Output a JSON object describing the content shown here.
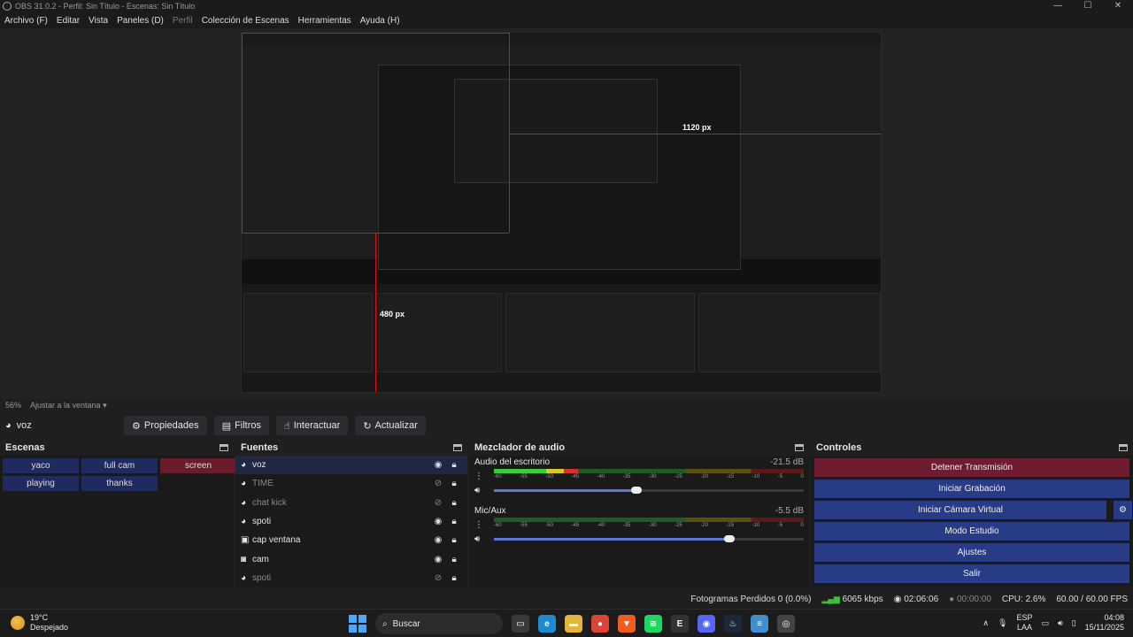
{
  "window": {
    "title": "OBS 31.0.2 - Perfil: Sin Título - Escenas: Sin Título",
    "controls": [
      "—",
      "☐",
      "✕"
    ]
  },
  "menu": [
    "Archivo (F)",
    "Editar",
    "Vista",
    "Paneles (D)",
    "Perfil",
    "Colección de Escenas",
    "Herramientas",
    "Ayuda (H)"
  ],
  "preview": {
    "dimension_h": "1120 px",
    "dimension_v": "480 px",
    "zoom": "56%",
    "fit_label": "Ajustar a la ventana"
  },
  "toolbar": {
    "source": "voz",
    "buttons": [
      {
        "icon": "gear-icon",
        "glyph": "⚙",
        "label": "Propiedades"
      },
      {
        "icon": "filter-icon",
        "glyph": "▤",
        "label": "Filtros"
      },
      {
        "icon": "hand-icon",
        "glyph": "☝",
        "label": "Interactuar"
      },
      {
        "icon": "refresh-icon",
        "glyph": "↻",
        "label": "Actualizar"
      }
    ]
  },
  "scenes": {
    "title": "Escenas",
    "items": [
      "yaco",
      "full cam",
      "screen",
      "playing",
      "thanks"
    ],
    "active": "screen"
  },
  "sources": {
    "title": "Fuentes",
    "items": [
      {
        "name": "voz",
        "icon": "mic-icon",
        "visible": true,
        "selected": true
      },
      {
        "name": "TIME",
        "icon": "text-icon",
        "visible": false
      },
      {
        "name": "chat kick",
        "icon": "browser-icon",
        "visible": false
      },
      {
        "name": "spoti",
        "icon": "browser-icon",
        "visible": true
      },
      {
        "name": "cap ventana",
        "icon": "window-capture-icon",
        "visible": true
      },
      {
        "name": "cam",
        "icon": "camera-icon",
        "visible": true
      },
      {
        "name": "spoti",
        "icon": "browser-icon",
        "visible": false
      }
    ]
  },
  "mixer": {
    "title": "Mezclador de audio",
    "ticks": [
      "-60",
      "-55",
      "-50",
      "-45",
      "-40",
      "-35",
      "-30",
      "-25",
      "-20",
      "-15",
      "-10",
      "-5",
      "0"
    ],
    "channels": [
      {
        "name": "Audio del escritorio",
        "db": "-21.5 dB",
        "level": 0.27,
        "volume": 0.46
      },
      {
        "name": "Mic/Aux",
        "db": "-5.5 dB",
        "level": 0.0,
        "volume": 0.76
      }
    ]
  },
  "controls": {
    "title": "Controles",
    "buttons": [
      "Detener Transmisión",
      "Iniciar Grabación",
      "Iniciar Cámara Virtual",
      "Modo Estudio",
      "Ajustes",
      "Salir"
    ]
  },
  "status": {
    "dropped": "Fotogramas Perdidos 0 (0.0%)",
    "bitrate": "6065 kbps",
    "stream_time": "02:06:06",
    "rec_time": "00:00:00",
    "cpu": "CPU: 2.6%",
    "fps": "60.00 / 60.00 FPS"
  },
  "taskbar": {
    "weather_temp": "19°C",
    "weather_desc": "Despejado",
    "search": "Buscar",
    "lang1": "ESP",
    "lang2": "LAA",
    "time": "04:08",
    "date": "15/11/2025",
    "apps": [
      {
        "name": "task-view-icon",
        "color": "#3a3a3a",
        "glyph": "▭"
      },
      {
        "name": "edge-icon",
        "color": "#1f8ad2",
        "glyph": "e"
      },
      {
        "name": "file-explorer-icon",
        "color": "#e5b53a",
        "glyph": "▬"
      },
      {
        "name": "chrome-icon",
        "color": "#db4437",
        "glyph": "●"
      },
      {
        "name": "brave-icon",
        "color": "#f25c1f",
        "glyph": "▼"
      },
      {
        "name": "spotify-icon",
        "color": "#1ed760",
        "glyph": "≋"
      },
      {
        "name": "epic-games-icon",
        "color": "#333333",
        "glyph": "E"
      },
      {
        "name": "discord-icon",
        "color": "#5865f2",
        "glyph": "◉"
      },
      {
        "name": "steam-icon",
        "color": "#1b2838",
        "glyph": "♨"
      },
      {
        "name": "notes-icon",
        "color": "#3e8ed0",
        "glyph": "≡"
      },
      {
        "name": "obs-icon",
        "color": "#444444",
        "glyph": "◎"
      }
    ]
  },
  "colors": {
    "accent_blue": "#283b86",
    "active_red": "#6f1c30",
    "meter_green": "#3aca3a",
    "guide_red": "#dd1111"
  }
}
